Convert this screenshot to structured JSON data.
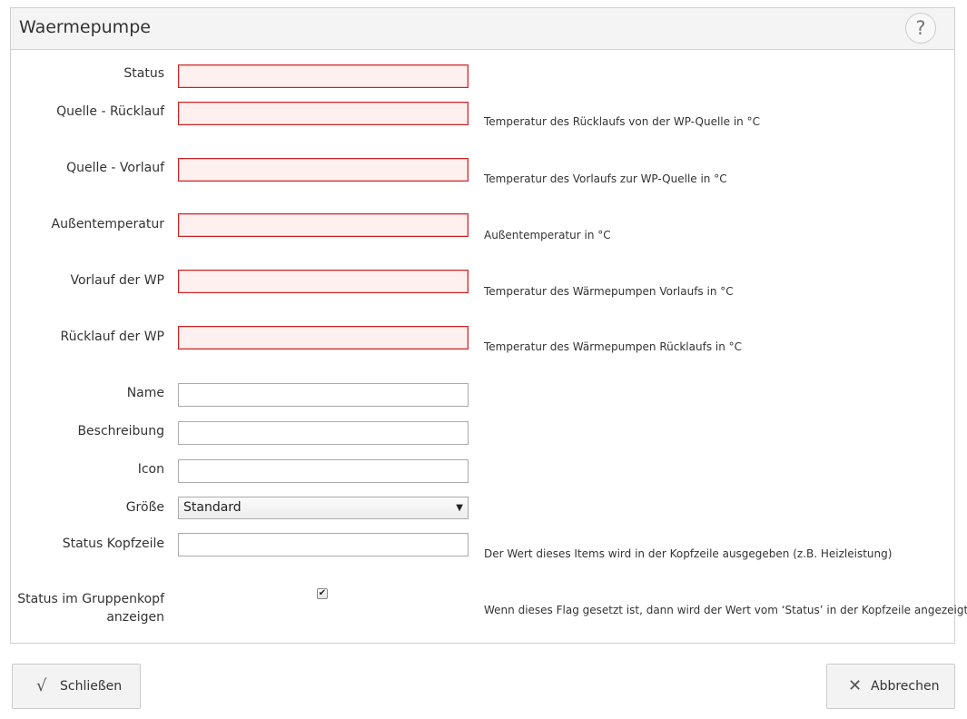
{
  "dialog": {
    "title": "Waermepumpe",
    "help_label": "?"
  },
  "form": {
    "status": {
      "label": "Status",
      "value": ""
    },
    "quelle_ruecklauf": {
      "label": "Quelle - Rücklauf",
      "value": "",
      "hint": "Temperatur des Rücklaufs von der WP-Quelle in °C"
    },
    "quelle_vorlauf": {
      "label": "Quelle - Vorlauf",
      "value": "",
      "hint": "Temperatur des Vorlaufs zur WP-Quelle in °C"
    },
    "aussentemperatur": {
      "label": "Außentemperatur",
      "value": "",
      "hint": "Außentemperatur in °C"
    },
    "vorlauf_wp": {
      "label": "Vorlauf der WP",
      "value": "",
      "hint": "Temperatur des Wärmepumpen Vorlaufs in °C"
    },
    "ruecklauf_wp": {
      "label": "Rücklauf der WP",
      "value": "",
      "hint": "Temperatur des Wärmepumpen Rücklaufs in °C"
    },
    "name": {
      "label": "Name",
      "value": ""
    },
    "beschreibung": {
      "label": "Beschreibung",
      "value": ""
    },
    "icon": {
      "label": "Icon",
      "value": ""
    },
    "groesse": {
      "label": "Größe",
      "selected": "Standard"
    },
    "status_kopfzeile": {
      "label": "Status Kopfzeile",
      "value": "",
      "hint": "Der Wert dieses Items wird in der Kopfzeile ausgegeben (z.B. Heizleistung)"
    },
    "status_gruppenkopf": {
      "label_line1": "Status im Gruppenkopf",
      "label_line2": "anzeigen",
      "checked": true,
      "hint": "Wenn dieses Flag gesetzt ist, dann wird der Wert vom ‘Status’ in der Kopfzeile angezeigt."
    }
  },
  "buttons": {
    "close_label": "Schließen",
    "cancel_label": "Abbrechen"
  },
  "colors": {
    "invalid_border": "#cc2222",
    "invalid_background": "#fff0f0",
    "header_background": "#f4f4f4"
  },
  "icons": {
    "close": "checkmark-icon",
    "cancel": "x-icon",
    "help": "question-icon"
  }
}
